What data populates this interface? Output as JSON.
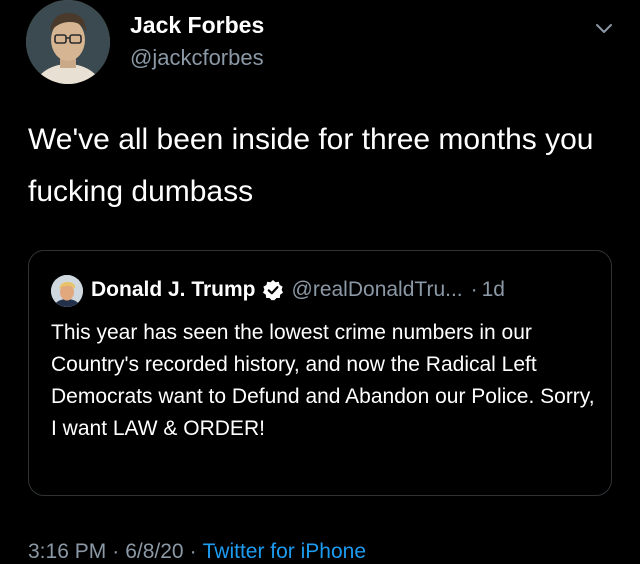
{
  "author": {
    "name": "Jack Forbes",
    "handle": "@jackcforbes"
  },
  "tweet": {
    "text": "We've all been inside for three months you fucking dumbass"
  },
  "quoted_tweet": {
    "name": "Donald J. Trump",
    "handle": "@realDonaldTru...",
    "separator": "·",
    "time": "1d",
    "text": "This year has seen the lowest crime numbers in our Country's recorded history, and now the Radical Left Democrats want to Defund and Abandon our Police. Sorry, I want LAW & ORDER!",
    "verified_icon": "verified-badge-icon"
  },
  "meta": {
    "time": "3:16 PM",
    "sep1": "·",
    "date": "6/8/20",
    "sep2": "·",
    "source": "Twitter for iPhone"
  },
  "colors": {
    "background": "#000000",
    "text": "#ffffff",
    "muted": "#8b98a5",
    "link": "#1d9bf0",
    "border": "#2f3336"
  },
  "icons": {
    "menu": "chevron-down-icon"
  }
}
